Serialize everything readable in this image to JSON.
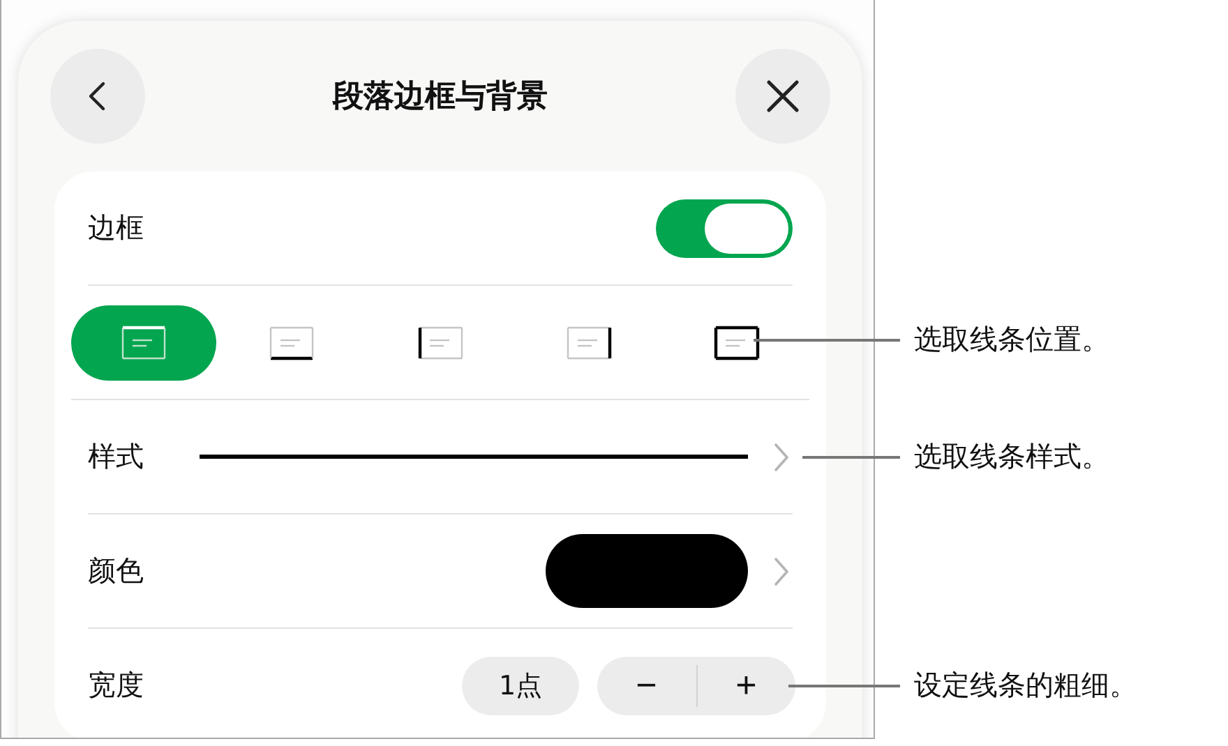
{
  "header": {
    "title": "段落边框与背景"
  },
  "border": {
    "label": "边框",
    "on": true
  },
  "positions": [
    {
      "kind": "top",
      "selected": true
    },
    {
      "kind": "bottom",
      "selected": false
    },
    {
      "kind": "left",
      "selected": false
    },
    {
      "kind": "right",
      "selected": false
    },
    {
      "kind": "outline",
      "selected": false
    }
  ],
  "style": {
    "label": "样式"
  },
  "color": {
    "label": "颜色",
    "color": "#000000"
  },
  "width": {
    "label": "宽度",
    "value": "1点",
    "minus": "−",
    "plus": "+"
  },
  "callouts": [
    {
      "kind": "positions",
      "text": "选取线条位置。"
    },
    {
      "kind": "style",
      "text": "选取线条样式。"
    },
    {
      "kind": "width",
      "text": "设定线条的粗细。"
    }
  ]
}
